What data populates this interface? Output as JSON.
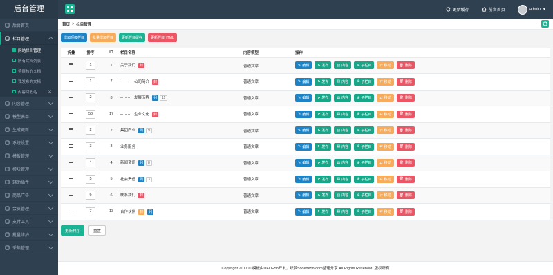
{
  "header": {
    "brand": "后台管理",
    "update_cache": "更新缓存",
    "site_home": "前台首页",
    "user": "admin"
  },
  "sidebar": {
    "items": [
      {
        "label": "后台首页",
        "icon": "home-icon"
      },
      {
        "label": "栏目管理",
        "icon": "list-icon",
        "open": true
      },
      {
        "label": "内容管理",
        "icon": "edit-icon"
      },
      {
        "label": "模型表单",
        "icon": "cube-icon"
      },
      {
        "label": "生成更新",
        "icon": "refresh-icon"
      },
      {
        "label": "系统设置",
        "icon": "gear-icon"
      },
      {
        "label": "模板管理",
        "icon": "layout-icon"
      },
      {
        "label": "模块管理",
        "icon": "module-icon"
      },
      {
        "label": "辅助插件",
        "icon": "plugin-icon"
      },
      {
        "label": "商品广告",
        "icon": "ad-icon"
      },
      {
        "label": "会员管理",
        "icon": "user-icon"
      },
      {
        "label": "支付工具",
        "icon": "pay-icon"
      },
      {
        "label": "批量维护",
        "icon": "wrench-icon"
      },
      {
        "label": "采集管理",
        "icon": "collect-icon"
      }
    ],
    "subitems": [
      {
        "label": "网站栏目管理",
        "active": true
      },
      {
        "label": "所有文档列表"
      },
      {
        "label": "待审核的文档"
      },
      {
        "label": "我发布的文档"
      },
      {
        "label": "内容回收站",
        "closable": true
      }
    ]
  },
  "breadcrumb": {
    "home": "首页",
    "current": "栏目管理"
  },
  "toolbar": {
    "add_top": "增加顶级栏目",
    "batch_add": "批量增加栏目",
    "update_cache": "更新栏目缓存",
    "update_html": "更新栏目HTML"
  },
  "table": {
    "headers": {
      "fold": "折叠",
      "sort": "排序",
      "id": "ID",
      "name": "栏目名称",
      "model": "内容模型",
      "ops": "操作"
    },
    "op_labels": {
      "edit": "编辑",
      "publish": "发布",
      "content": "内容",
      "sub": "子栏目",
      "move": "移动",
      "delete": "删除"
    },
    "rows": [
      {
        "fold": "open",
        "sort": "1",
        "id": "1",
        "name": "关于我们",
        "tag": "封",
        "tagtype": "page2",
        "count": "",
        "level": 0,
        "model": "普通文章"
      },
      {
        "fold": "line",
        "sort": "1",
        "id": "7",
        "name": "公司简介",
        "tag": "封",
        "tagtype": "page2",
        "count": "",
        "level": 1,
        "model": "普通文章"
      },
      {
        "fold": "line",
        "sort": "2",
        "id": "8",
        "name": "发展历程",
        "tag": "列",
        "tagtype": "list",
        "count": "11",
        "level": 1,
        "model": "普通文章"
      },
      {
        "fold": "line",
        "sort": "50",
        "id": "17",
        "name": "企业文化",
        "tag": "封",
        "tagtype": "page2",
        "count": "",
        "level": 1,
        "model": "普通文章"
      },
      {
        "fold": "open",
        "sort": "2",
        "id": "2",
        "name": "集团产业",
        "tag": "列",
        "tagtype": "list",
        "count": "9",
        "level": 0,
        "model": "普通文章"
      },
      {
        "fold": "open",
        "sort": "3",
        "id": "3",
        "name": "业务服务",
        "tag": "",
        "tagtype": "",
        "count": "",
        "level": 0,
        "model": "普通文章"
      },
      {
        "fold": "line",
        "sort": "4",
        "id": "4",
        "name": "新闻资讯",
        "tag": "列",
        "tagtype": "list",
        "count": "8",
        "level": 0,
        "model": "普通文章"
      },
      {
        "fold": "line",
        "sort": "5",
        "id": "5",
        "name": "社会责任",
        "tag": "列",
        "tagtype": "list",
        "count": "3",
        "level": 0,
        "model": "普通文章"
      },
      {
        "fold": "line",
        "sort": "6",
        "id": "6",
        "name": "联系我们",
        "tag": "封",
        "tagtype": "page2",
        "count": "",
        "level": 0,
        "model": "普通文章"
      },
      {
        "fold": "line",
        "sort": "7",
        "id": "13",
        "name": "合作伙伴",
        "tag": "封",
        "tagtype": "page",
        "tag2": "列",
        "count": "",
        "level": 0,
        "model": "普通文章"
      }
    ]
  },
  "bottom": {
    "update_sort": "更新排序",
    "reset": "重置"
  },
  "footer": {
    "text": "Copyright 2017 © 模板由DEDE58开发，织梦58dede58.com整理分享 All Rights Reserved. 版权所有"
  },
  "colors": {
    "accent": "#1ab394",
    "sidebar": "#2f4050",
    "blue": "#1c84c6",
    "yellow": "#f8ac59",
    "red": "#ed5565"
  }
}
